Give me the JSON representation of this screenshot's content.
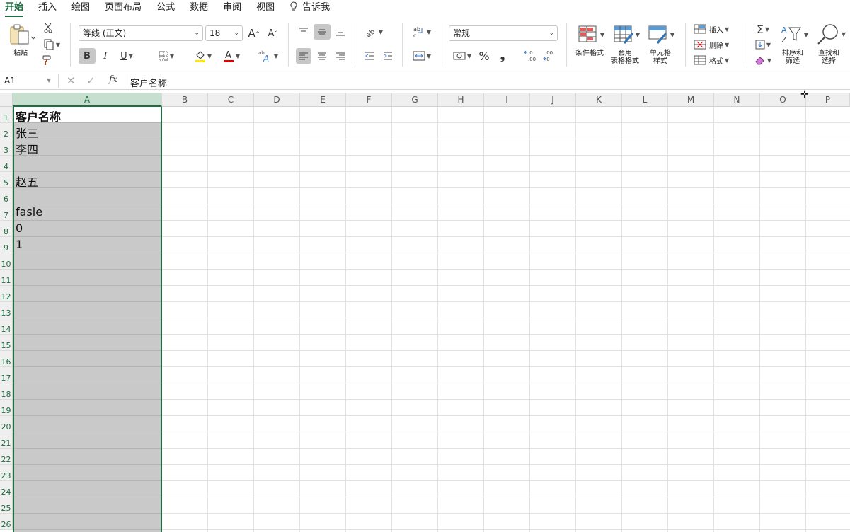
{
  "tabs": [
    "开始",
    "插入",
    "绘图",
    "页面布局",
    "公式",
    "数据",
    "审阅",
    "视图",
    "告诉我"
  ],
  "ribbon": {
    "paste_label": "粘贴",
    "font_name": "等线 (正文)",
    "font_size": "18",
    "grow_font": "A",
    "shrink_font": "A",
    "bold": "B",
    "italic": "I",
    "underline": "U",
    "number_format": "常规",
    "percent": "%",
    "comma": "❟",
    "conditional_format": "条件格式",
    "table_format_line1": "套用",
    "table_format_line2": "表格格式",
    "cell_style_line1": "单元格",
    "cell_style_line2": "样式",
    "insert": "插入",
    "delete": "删除",
    "format": "格式",
    "sort_filter_line1": "排序和",
    "sort_filter_line2": "筛选",
    "find_select_line1": "查找和",
    "find_select_line2": "选择",
    "accent_color": "#1d6f42"
  },
  "formula_bar": {
    "name_box": "A1",
    "fx": "fx",
    "content": "客户名称"
  },
  "columns": [
    "A",
    "B",
    "C",
    "D",
    "E",
    "F",
    "G",
    "H",
    "I",
    "J",
    "K",
    "L",
    "M",
    "N",
    "O",
    "P"
  ],
  "rows": [
    "1",
    "2",
    "3",
    "4",
    "5",
    "6",
    "7",
    "8",
    "9",
    "10",
    "11",
    "12",
    "13",
    "14",
    "15",
    "16",
    "17",
    "18",
    "19",
    "20",
    "21",
    "22",
    "23",
    "24",
    "25",
    "26"
  ],
  "cells_A": [
    "客户名称",
    "张三",
    "李四",
    "",
    "赵五",
    "",
    "fasle",
    "0",
    "1"
  ]
}
